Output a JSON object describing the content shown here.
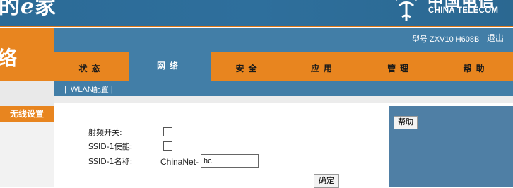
{
  "banner": {
    "brand_prefix": "的",
    "brand_e": "e",
    "brand_suffix": "家",
    "logo_cn": "中国电信",
    "logo_en": "CHINA TELECOM"
  },
  "sidebar": {
    "section_title": "络",
    "items": [
      {
        "label": "无线设置",
        "active": true
      }
    ]
  },
  "header": {
    "model_label": "型号  ZXV10  H608B",
    "logout_label": "退出"
  },
  "nav": {
    "tabs": [
      {
        "label": "状态",
        "active": false
      },
      {
        "label": "网络",
        "active": true
      },
      {
        "label": "安全",
        "active": false
      },
      {
        "label": "应用",
        "active": false
      },
      {
        "label": "管理",
        "active": false
      },
      {
        "label": "帮助",
        "active": false
      }
    ]
  },
  "subnav": {
    "sep_left": "|",
    "item": "WLAN配置",
    "sep_right": "|"
  },
  "form": {
    "radio_switch_label": "射频开关:",
    "radio_switch_checked": false,
    "ssid1_enable_label": "SSID-1使能:",
    "ssid1_enable_checked": false,
    "ssid1_name_label": "SSID-1名称:",
    "ssid1_prefix": "ChinaNet-",
    "ssid1_value": "hc",
    "confirm_label": "确定"
  },
  "help_panel": {
    "help_label": "帮助"
  },
  "colors": {
    "accent_orange": "#e8851f",
    "header_blue": "#427ea7",
    "banner_blue": "#2c6b97",
    "help_panel_blue": "#4f7fa5"
  }
}
